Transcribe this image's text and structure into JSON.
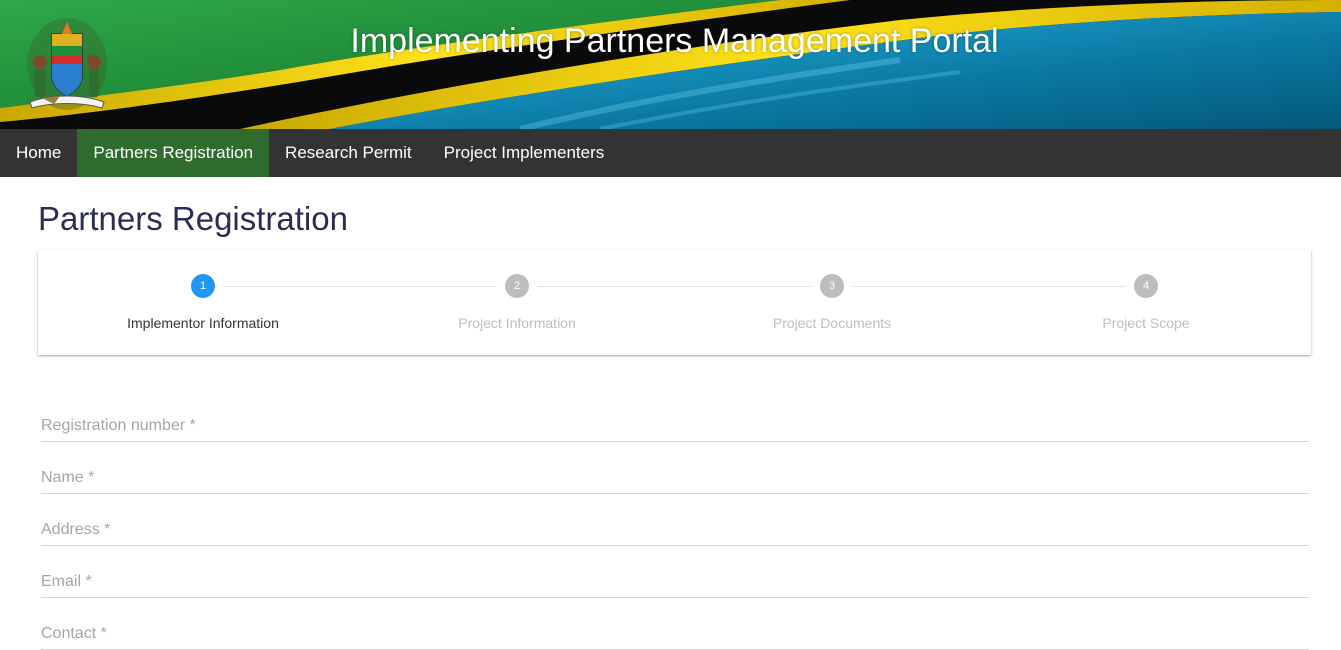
{
  "header": {
    "title": "Implementing Partners Management Portal",
    "colors": {
      "green": "#1e9e3a",
      "yellow": "#f0d000",
      "black": "#0a0a0a",
      "blue": "#0d6a8e"
    },
    "emblem_icon": "coat-of-arms-icon"
  },
  "nav": {
    "items": [
      {
        "label": "Home",
        "active": false
      },
      {
        "label": "Partners Registration",
        "active": true
      },
      {
        "label": "Research Permit",
        "active": false
      },
      {
        "label": "Project Implementers",
        "active": false
      }
    ],
    "active_color": "#2e6b2c"
  },
  "page": {
    "title": "Partners Registration"
  },
  "stepper": {
    "steps": [
      {
        "number": "1",
        "label": "Implementor Information",
        "active": true
      },
      {
        "number": "2",
        "label": "Project Information",
        "active": false
      },
      {
        "number": "3",
        "label": "Project Documents",
        "active": false
      },
      {
        "number": "4",
        "label": "Project Scope",
        "active": false
      }
    ],
    "active_color": "#2196f3",
    "inactive_color": "#bdbdbd"
  },
  "form": {
    "fields": [
      {
        "placeholder": "Registration number *",
        "value": ""
      },
      {
        "placeholder": "Name *",
        "value": ""
      },
      {
        "placeholder": "Address *",
        "value": ""
      },
      {
        "placeholder": "Email *",
        "value": ""
      },
      {
        "placeholder": "Contact *",
        "value": ""
      }
    ]
  }
}
